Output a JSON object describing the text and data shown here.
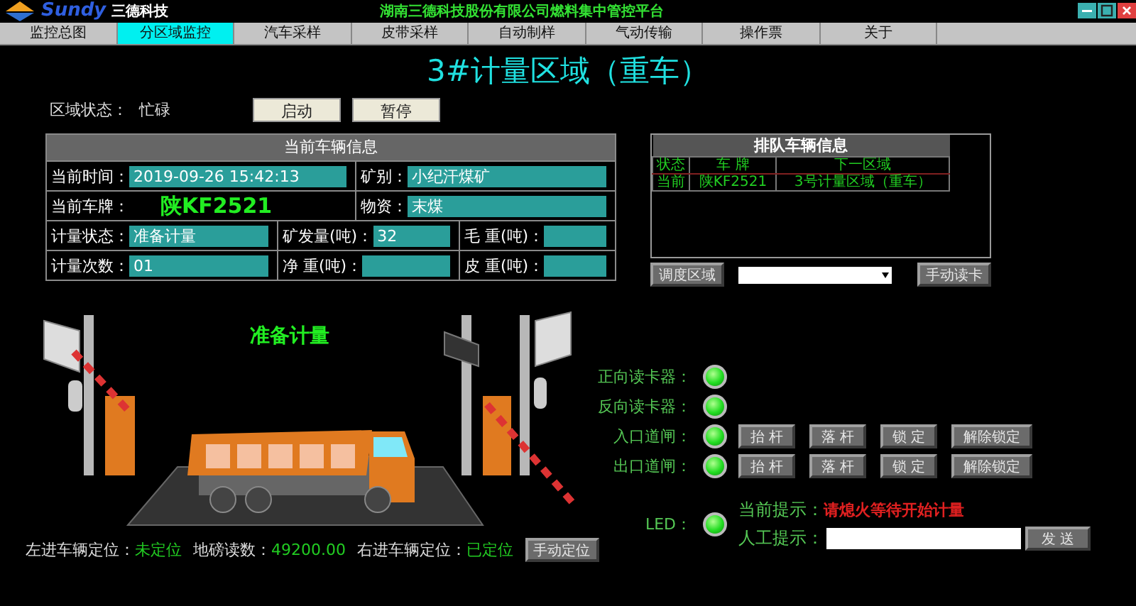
{
  "header": {
    "brand": "Sundy",
    "brand_cn": "三德科技",
    "title": "湖南三德科技股份有限公司燃料集中管控平台"
  },
  "nav": [
    {
      "label": "监控总图",
      "selected": false
    },
    {
      "label": "分区域监控",
      "selected": true
    },
    {
      "label": "汽车采样",
      "selected": false
    },
    {
      "label": "皮带采样",
      "selected": false
    },
    {
      "label": "自动制样",
      "selected": false
    },
    {
      "label": "气动传输",
      "selected": false
    },
    {
      "label": "操作票",
      "selected": false
    },
    {
      "label": "关于",
      "selected": false
    }
  ],
  "page_title": "3#计量区域（重车）",
  "region_status": {
    "label": "区域状态：",
    "value": "忙碌"
  },
  "region_buttons": [
    "启动",
    "暂停"
  ],
  "vehicle_info": {
    "title": "当前车辆信息",
    "rows": [
      {
        "cells": [
          {
            "kind": "field",
            "label": "当前时间：",
            "value": "2019-09-26 15:42:13"
          },
          {
            "kind": "field",
            "label": "矿别：",
            "value": "小纪汗煤矿"
          }
        ]
      },
      {
        "cells": [
          {
            "kind": "plate",
            "label": "当前车牌：",
            "value": "陕KF2521"
          },
          {
            "kind": "field",
            "label": "物资：",
            "value": "末煤"
          }
        ]
      },
      {
        "cells": [
          {
            "kind": "field",
            "label": "计量状态：",
            "value": "准备计量"
          },
          {
            "kind": "field",
            "label": "矿发量(吨)：",
            "value": "32"
          },
          {
            "kind": "field",
            "label": "毛 重(吨)："
          }
        ]
      },
      {
        "cells": [
          {
            "kind": "field",
            "label": "计量次数：",
            "value": "01"
          },
          {
            "kind": "field",
            "label": "净 重(吨)："
          },
          {
            "kind": "field",
            "label": "皮 重(吨)："
          }
        ]
      }
    ]
  },
  "queue": {
    "title": "排队车辆信息",
    "columns": [
      "状态",
      "车 牌",
      "下一区域"
    ],
    "rows": [
      [
        "当前",
        "陕KF2521",
        "3号计量区域（重车）"
      ]
    ]
  },
  "queue_controls": {
    "dispatch_button": "调度区域",
    "read_card_button": "手动读卡"
  },
  "scene": {
    "caption": "准备计量"
  },
  "positioning": {
    "items": [
      {
        "label": "左进车辆定位：",
        "value": "未定位"
      },
      {
        "label": "地磅读数：",
        "value": "49200.00"
      },
      {
        "label": "右进车辆定位：",
        "value": "已定位"
      }
    ],
    "button": "手动定位"
  },
  "devices": [
    {
      "label": "正向读卡器：",
      "on": true
    },
    {
      "label": "反向读卡器：",
      "on": true
    },
    {
      "label": "入口道闸：",
      "on": true,
      "buttons": [
        "抬 杆",
        "落 杆",
        "锁 定",
        "解除锁定"
      ]
    },
    {
      "label": "出口道闸：",
      "on": true,
      "buttons": [
        "抬 杆",
        "落 杆",
        "锁 定",
        "解除锁定"
      ]
    }
  ],
  "led": {
    "label": "LED：",
    "on": true,
    "current_label": "当前提示：",
    "current_text": "请熄火等待开始计量",
    "manual_label": "人工提示：",
    "send_button": "发 送"
  }
}
